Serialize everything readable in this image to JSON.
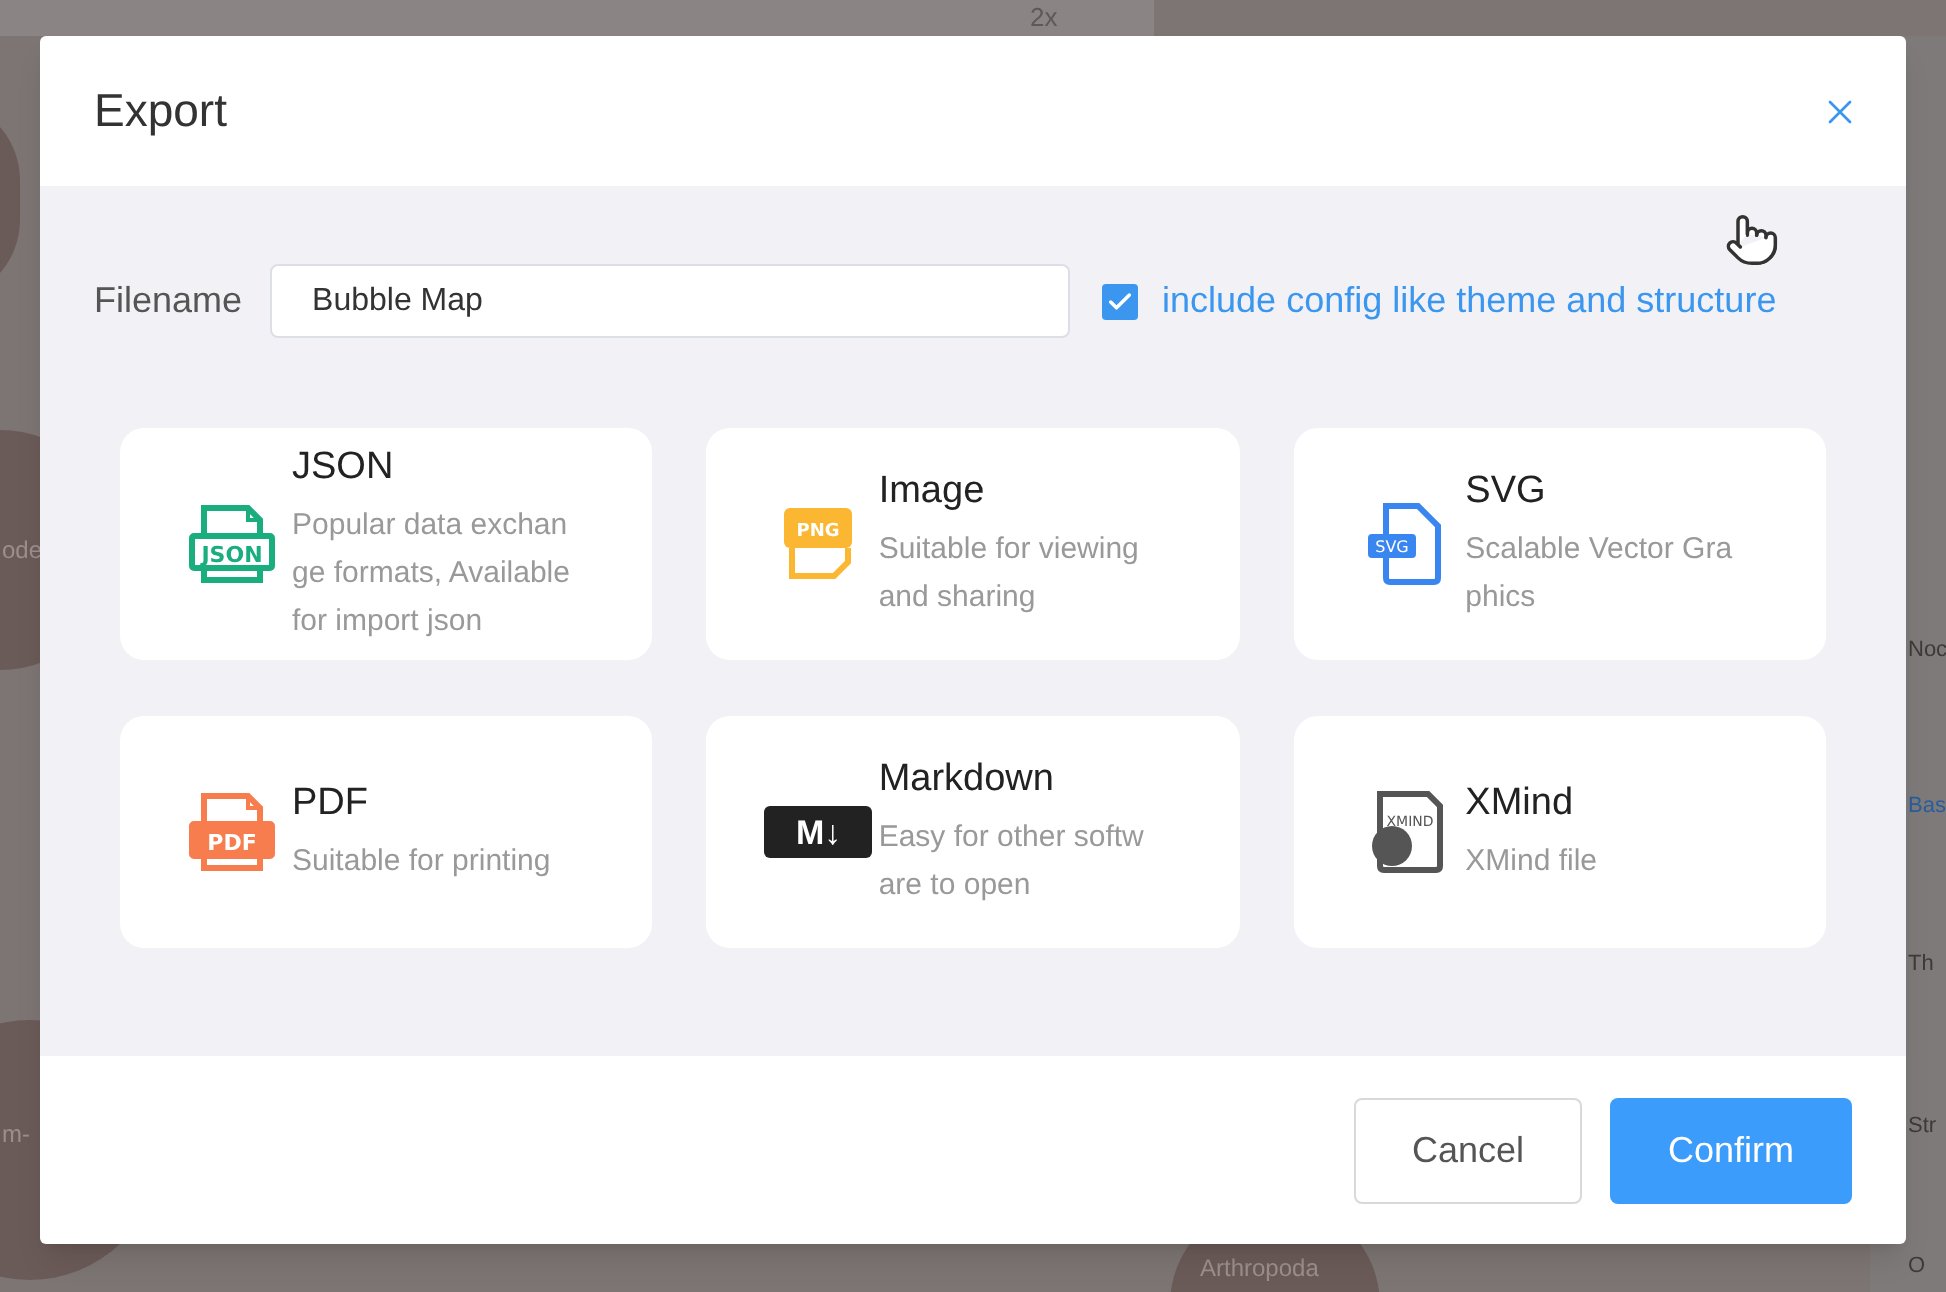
{
  "background": {
    "toolbar_text": "2x",
    "node_texts": [
      "ode",
      "m-",
      "Arthropoda"
    ],
    "panel_texts": [
      "Noc",
      "Bas",
      "Th",
      "Str",
      "O"
    ]
  },
  "dialog": {
    "title": "Export",
    "filename": {
      "label": "Filename",
      "value": "Bubble Map"
    },
    "include_config": {
      "label": "include config like theme and structure",
      "checked": true
    },
    "formats": [
      {
        "kind": "file",
        "title": "JSON",
        "description": "Popular data exchan ge formats, Available for import json",
        "icon_label": "JSON",
        "color": "#1aad7e"
      },
      {
        "kind": "image",
        "title": "Image",
        "description": "Suitable for viewing and sharing",
        "icon_label": "PNG",
        "color": "#fbb731"
      },
      {
        "kind": "tag",
        "title": "SVG",
        "description": "Scalable Vector Gra phics",
        "icon_label": "SVG",
        "color": "#3a86f0"
      },
      {
        "kind": "file",
        "title": "PDF",
        "description": "Suitable for printing",
        "icon_label": "PDF",
        "color": "#f87d4e"
      },
      {
        "kind": "markdown",
        "title": "Markdown",
        "description": "Easy for other softw are to open",
        "icon_label": "M↓",
        "color": "#222222"
      },
      {
        "kind": "xmind",
        "title": "XMind",
        "description": "XMind file",
        "icon_label": "XMIND",
        "color": "#555555"
      }
    ],
    "buttons": [
      {
        "kind": "secondary",
        "label": "Cancel"
      },
      {
        "kind": "primary",
        "label": "Confirm"
      }
    ]
  }
}
